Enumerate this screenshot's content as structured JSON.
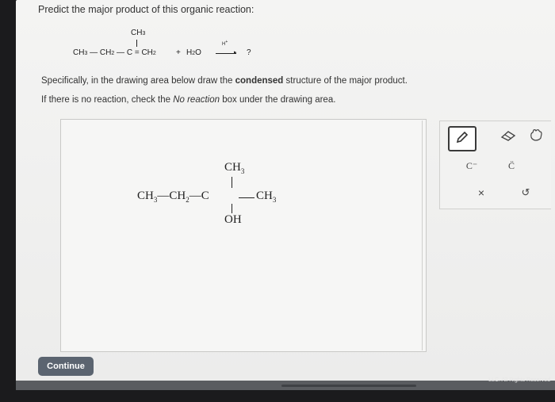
{
  "question": {
    "prompt": "Predict the major product of this organic reaction:"
  },
  "reaction": {
    "branch": "CH3",
    "chain": "CH3 — CH2 — C = CH2",
    "plus": "+",
    "reagent": "H2O",
    "condition": "H+",
    "product": "?"
  },
  "instructions": {
    "line1_pre": "Specifically, in the drawing area below draw the ",
    "line1_bold": "condensed",
    "line1_post": " structure of the major product.",
    "line2_pre": "If there is no reaction, check the ",
    "line2_italic": "No reaction",
    "line2_post": " box under the drawing area."
  },
  "drawing": {
    "top_group": "CH3",
    "left_chain": "CH3—CH2—C",
    "right_group": "CH3",
    "bottom_group": "OH"
  },
  "toolbar": {
    "pencil": "pencil-icon",
    "eraser": "eraser-icon",
    "hand": "hand-icon",
    "carbanion": "C⁻",
    "carbene": "C̈",
    "clear": "×",
    "undo": "↺"
  },
  "continue_label": "Continue",
  "footer": {
    "copyright": "LLC. All Rights Reserved"
  }
}
